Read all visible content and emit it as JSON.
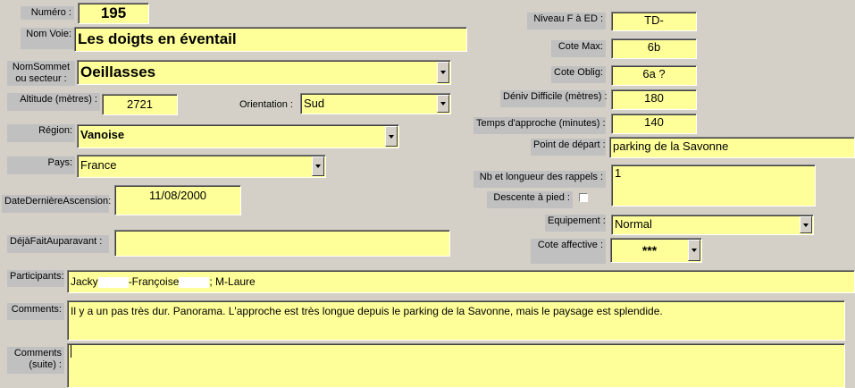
{
  "numero": {
    "label": "Numéro :",
    "value": "195"
  },
  "nom_voie": {
    "label": "Nom Voie:",
    "value": "Les doigts en éventail"
  },
  "nom_sommet": {
    "label": "NomSommet ou secteur :",
    "value": "Oeillasses"
  },
  "altitude": {
    "label": "Altitude (mètres) :",
    "value": "2721"
  },
  "orientation": {
    "label": "Orientation :",
    "value": "Sud"
  },
  "region": {
    "label": "Région:",
    "value": "Vanoise"
  },
  "pays": {
    "label": "Pays:",
    "value": "France"
  },
  "date_derniere": {
    "label": "DateDernièreAscension:",
    "value": "11/08/2000"
  },
  "deja_fait": {
    "label": "DéjàFaitAuparavant :",
    "value": ""
  },
  "niveau": {
    "label": "Niveau F à ED :",
    "value": "TD-"
  },
  "cote_max": {
    "label": "Cote Max:",
    "value": "6b"
  },
  "cote_oblig": {
    "label": "Cote Oblig:",
    "value": "6a ?"
  },
  "deniv": {
    "label": "Déniv Difficile (mètres) :",
    "value": "180"
  },
  "temps_approche": {
    "label": "Temps d'approche (minutes) :",
    "value": "140"
  },
  "point_depart": {
    "label": "Point de départ :",
    "value": "parking de la Savonne"
  },
  "rappels": {
    "label": "Nb et longueur des rappels :",
    "value": "1"
  },
  "descente": {
    "label": "Descente à pied :"
  },
  "equipement": {
    "label": "Equipement :",
    "value": "Normal"
  },
  "cote_affective": {
    "label": "Cote affective :",
    "value": "***"
  },
  "participants": {
    "label": "Participants:",
    "part1": "Jacky",
    "part2": "-Françoise",
    "part3": "; M-Laure"
  },
  "comments": {
    "label": "Comments:",
    "value": "Il y a un pas très dur. Panorama. L'approche est très longue depuis le parking de la Savonne, mais le paysage est splendide."
  },
  "comments_suite": {
    "label": "Comments (suite) :",
    "value": ""
  },
  "colors": {
    "field": "#ffff99",
    "label": "#c0c0c0",
    "background": "#d4d0c8"
  }
}
